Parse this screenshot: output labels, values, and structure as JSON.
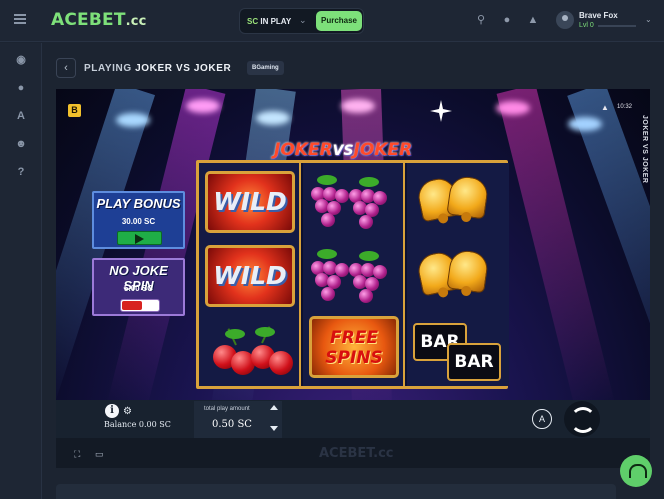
{
  "header": {
    "logo_main": "ACEBET",
    "logo_suffix": ".cc",
    "mode_prefix": "SC",
    "mode_label": "IN PLAY",
    "purchase_label": "Purchase",
    "user_name": "Brave Fox",
    "user_level": "Lvl 0"
  },
  "page": {
    "title_prefix": "PLAYING",
    "game_name": "JOKER VS JOKER",
    "provider": "BGaming"
  },
  "game": {
    "logo_left": "JOKER",
    "logo_vs": "VS",
    "logo_right": "JOKER",
    "vertical_title": "JOKER VS JOKER",
    "clock": "10:32",
    "provider_badge": "B",
    "play_bonus_title": "PLAY BONUS",
    "play_bonus_price": "30.00 SC",
    "no_joke_title": "NO JOKE SPIN",
    "no_joke_price": "5.00 SC",
    "wild_label": "WILD",
    "free_spins_line1": "FREE",
    "free_spins_line2": "SPINS",
    "bar_label": "BAR",
    "balance_text": "Balance 0.00 SC",
    "total_play_label": "total play amount",
    "total_play_value": "0.50 SC",
    "auto_label": "A"
  },
  "footer": {
    "watermark": "ACEBET.cc"
  },
  "colors": {
    "accent": "#7ee07a",
    "background": "#1c2431",
    "reel_border": "#d9a23b"
  }
}
